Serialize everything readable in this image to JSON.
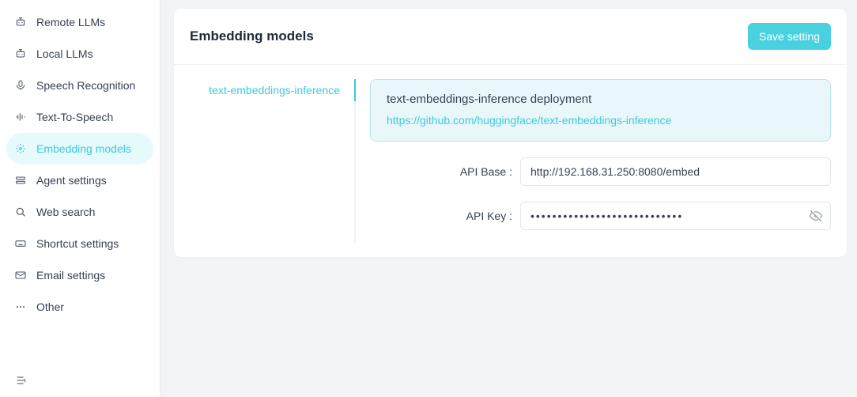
{
  "sidebar": {
    "items": [
      {
        "label": "Remote LLMs",
        "icon": "robot-icon"
      },
      {
        "label": "Local LLMs",
        "icon": "robot-icon"
      },
      {
        "label": "Speech Recognition",
        "icon": "mic-icon"
      },
      {
        "label": "Text-To-Speech",
        "icon": "wave-icon"
      },
      {
        "label": "Embedding models",
        "icon": "sparkle-icon",
        "active": true
      },
      {
        "label": "Agent settings",
        "icon": "layers-icon"
      },
      {
        "label": "Web search",
        "icon": "search-icon"
      },
      {
        "label": "Shortcut settings",
        "icon": "keyboard-icon"
      },
      {
        "label": "Email settings",
        "icon": "mail-icon"
      },
      {
        "label": "Other",
        "icon": "dots-icon"
      }
    ]
  },
  "panel": {
    "title": "Embedding models",
    "save_label": "Save setting"
  },
  "tabs": [
    {
      "label": "text-embeddings-inference",
      "active": true
    }
  ],
  "info": {
    "title": "text-embeddings-inference deployment",
    "link_text": "https://github.com/huggingface/text-embeddings-inference",
    "link_href": "https://github.com/huggingface/text-embeddings-inference"
  },
  "fields": {
    "api_base": {
      "label": "API Base :",
      "value": "http://192.168.31.250:8080/embed"
    },
    "api_key": {
      "label": "API Key :",
      "value": "••••••••••••••••••••••••••••"
    }
  },
  "colors": {
    "accent": "#3ccbd9"
  }
}
